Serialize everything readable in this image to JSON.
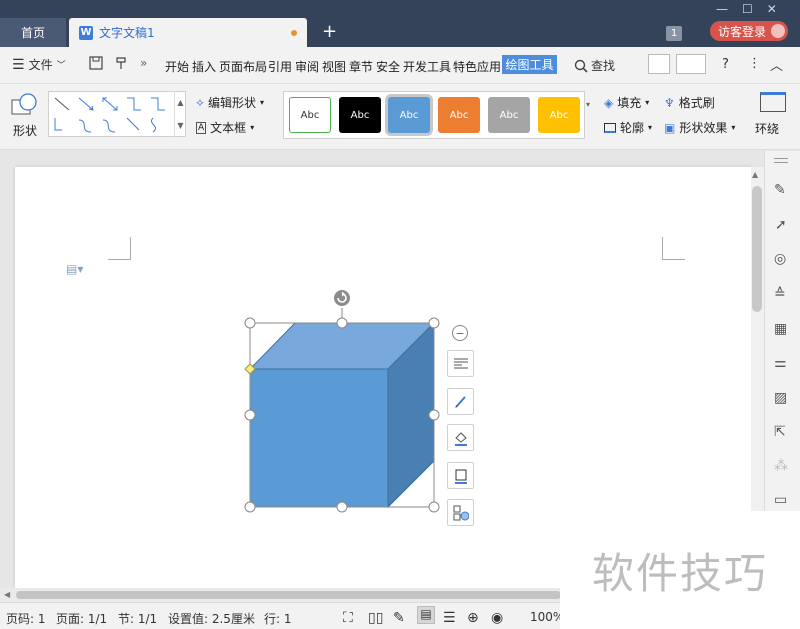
{
  "tabs": {
    "home": "首页",
    "document": "文字文稿1",
    "doc_icon": "W",
    "add": "+"
  },
  "window": {
    "badge": "1",
    "login": "访客登录",
    "controls": [
      "—",
      "☐",
      "✕"
    ]
  },
  "menu": {
    "file": "文件",
    "items": [
      "开始",
      "插入",
      "页面布局",
      "引用",
      "审阅",
      "视图",
      "章节",
      "安全",
      "开发工具",
      "特色应用"
    ],
    "active": "绘图工具",
    "search": "查找"
  },
  "ribbon": {
    "shape": "形状",
    "edit_shape": "编辑形状",
    "text_box": "文本框",
    "style_label": "Abc",
    "fill": "填充",
    "format_brush": "格式刷",
    "outline": "轮廓",
    "shape_effect": "形状效果",
    "wrap": "环绕"
  },
  "styles": [
    {
      "bg": "#ffffff",
      "fg": "#333333",
      "border": "#4caf50"
    },
    {
      "bg": "#000000",
      "fg": "#ffffff",
      "border": "#000000"
    },
    {
      "bg": "#5b9bd5",
      "fg": "#ffffff",
      "border": "#5b9bd5"
    },
    {
      "bg": "#ed7d31",
      "fg": "#ffffff",
      "border": "#ed7d31"
    },
    {
      "bg": "#a5a5a5",
      "fg": "#ffffff",
      "border": "#a5a5a5"
    },
    {
      "bg": "#ffc000",
      "fg": "#ffffff",
      "border": "#ffc000"
    }
  ],
  "status": {
    "page_code": "页码: 1",
    "pages": "页面: 1/1",
    "section": "节: 1/1",
    "setting": "设置值: 2.5厘米",
    "row": "行: 1",
    "zoom": "100%"
  },
  "watermark": "软件技巧",
  "colors": {
    "tabbar": "#34435a",
    "accent": "#4e8ddd",
    "cube_front": "#5b9bd5",
    "cube_top": "#79a9dc",
    "cube_side": "#4a7fb3"
  }
}
